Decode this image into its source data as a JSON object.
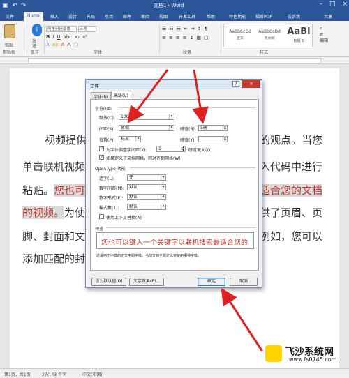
{
  "window": {
    "title": "文档1 - Word"
  },
  "quick_access": [
    "save-icon",
    "undo-icon",
    "redo-icon"
  ],
  "tabs": [
    "文件",
    "Home",
    "插入",
    "设计",
    "布局",
    "引用",
    "邮件",
    "审阅",
    "视图",
    "开发工具",
    "帮助",
    "特色功能",
    "福昕PDF",
    "告诉我",
    "共享"
  ],
  "ribbon": {
    "clipboard": {
      "paste_label": "粘贴",
      "group": "剪贴板"
    },
    "bluetooth": {
      "label1": "发",
      "label2": "送",
      "group": "蓝牙"
    },
    "font": {
      "name": "阿里巴巴普惠",
      "size": "三号",
      "group": "字体"
    },
    "paragraph": {
      "group": "段落"
    },
    "styles": {
      "items": [
        {
          "preview": "AaBbCcDd",
          "label": "正文"
        },
        {
          "preview": "AaBbCcDd",
          "label": "无间隔"
        },
        {
          "preview": "AaBl",
          "label": "标题 1"
        }
      ],
      "group": "样式"
    },
    "editing": {
      "label": "编辑"
    }
  },
  "document": {
    "lines": [
      {
        "pre": "视频提供",
        "hl": "",
        "post": "的观点。当您"
      },
      {
        "pre": "单击联机视频",
        "hl": "",
        "post": "入代码中进行"
      },
      {
        "pre": "粘贴。",
        "hl": "您也可",
        "post": ""
      },
      {
        "pre": "",
        "hl": "的视频。",
        "post": "为使"
      },
      {
        "pre": "脚、封面和文",
        "hl": "",
        "post": "例如，您可以"
      },
      {
        "pre": "添加匹配的封",
        "hl": "",
        "post": ""
      }
    ],
    "right_frag_line3": "适合您的文档",
    "right_frag_line4": "供了页眉、页"
  },
  "dialog": {
    "title": "字体",
    "help": "?",
    "tabs": [
      "字体(N)",
      "高级(V)"
    ],
    "spacing_section": "字符间距",
    "scale_label": "缩放(C):",
    "scale_value": "100%",
    "spacing_label": "间距(S):",
    "spacing_value": "紧缩",
    "by_label": "磅值(B):",
    "by_value": "5磅",
    "position_label": "位置(P):",
    "position_value": "标准",
    "pos_by_label": "磅值(Y):",
    "kerning_label": "为字体调整字间距(K):",
    "kerning_value": "1",
    "kerning_suffix": "磅或更大(O)",
    "grid_label": "如果定义了文档网格，则对齐到网格(W)",
    "opentype_section": "OpenType 功能",
    "ligatures_label": "连字(L):",
    "ligatures_value": "无",
    "numspacing_label": "数字间距(M):",
    "numspacing_value": "默认",
    "numforms_label": "数字形式(E):",
    "numforms_value": "默认",
    "stylesets_label": "样式集(T):",
    "stylesets_value": "默认",
    "contextual_label": "使用上下文替换(A)",
    "preview_section": "预览",
    "preview_text": "您也可以键入一个关键字以联机搜索最适合您的",
    "preview_note": "这是用于中文的正文主题字体。当前文档主题定义将使用哪种字体。",
    "default_btn": "设为默认值(D)",
    "effects_btn": "文字效果(E)...",
    "ok_btn": "确定",
    "cancel_btn": "取消"
  },
  "status": {
    "page": "第1页，共1页",
    "words": "27/143 个字",
    "lang": "中文(中国)"
  },
  "watermark": {
    "name": "飞沙系统网",
    "url": "www.fs0745.com"
  },
  "colors": {
    "accent": "#2b579a",
    "arrow": "#e02020",
    "highlight_text": "#c0392b"
  }
}
